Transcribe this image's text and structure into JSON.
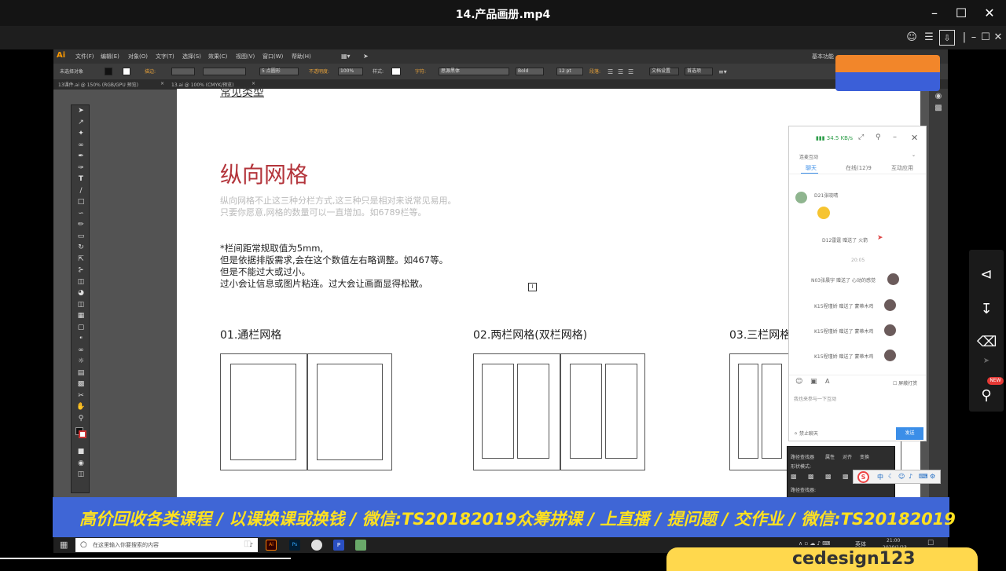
{
  "window": {
    "title": "14.产品画册.mp4"
  },
  "illustrator": {
    "logo": "Ai",
    "menu": [
      "文件(F)",
      "编辑(E)",
      "对象(O)",
      "文字(T)",
      "选择(S)",
      "效果(C)",
      "视图(V)",
      "窗口(W)",
      "帮助(H)"
    ],
    "workspace": "基本功能",
    "control": {
      "no_selection": "未选择对象",
      "stroke_label": "描边:",
      "stroke_type": "5 点圆形",
      "opacity_label": "不透明度:",
      "opacity": "100%",
      "style_label": "样式:",
      "char_label": "字符:",
      "font": "思源黑体",
      "weight": "Bold",
      "size": "12 pt",
      "para_label": "段落:",
      "doc_setup": "文档设置",
      "prefs": "首选项"
    },
    "tabs": [
      "13课件.ai @ 150% (RGB/GPU 预览)",
      "13.ai @ 100% (CMYK/预览)"
    ]
  },
  "artboard": {
    "cut_title": "常见类型",
    "title": "纵向网格",
    "sub": [
      "纵向网格不止这三种分栏方式,这三种只是相对来说常见易用。",
      "只要你愿意,网格的数量可以一直增加。如6789栏等。"
    ],
    "notes": [
      "*栏间距常规取值为5mm,",
      "但是依据排版需求,会在这个数值左右略调整。如467等。",
      "但是不能过大或过小。",
      "过小会让信息或图片粘连。过大会让画面显得松散。"
    ],
    "grids": [
      "01.通栏网格",
      "02.两栏网格(双栏网格)",
      "03.三栏网格"
    ]
  },
  "chat": {
    "speed": "34.5 KB/s",
    "section": "连麦互动",
    "tabs": [
      "聊天",
      "在线(12)9",
      "互动应用"
    ],
    "messages": [
      {
        "user": "D21张晓晴",
        "text": ""
      },
      {
        "user": "",
        "text": "D12雷霆 赠送了 火箭"
      },
      {
        "user": "",
        "text": "20:05"
      },
      {
        "user": "",
        "text": "N03张晨宇 赠送了 心动的感觉"
      },
      {
        "user": "",
        "text": "K15程瑾娇 赠送了 蒙蒂木鸡"
      },
      {
        "user": "",
        "text": "K15程瑾娇 赠送了 蒙蒂木鸡"
      },
      {
        "user": "",
        "text": "K15程瑾娇 赠送了 蒙蒂木鸡"
      }
    ],
    "input_placeholder": "我也来参与一下互动",
    "screen_lock": "屏蔽打赏",
    "mute": "禁止聊天",
    "send": "发送"
  },
  "layers_panel": {
    "tabs": [
      "路径查找器",
      "属性",
      "对齐",
      "变换"
    ],
    "shape_modes": "形状模式:",
    "pathfinder": "路径查找器:"
  },
  "ime": {
    "text": "中"
  },
  "banner": {
    "left": "高价回收各类课程 / 以课换课或换钱 / 微信:TS20182019",
    "right": "众筹拼课 / 上直播 / 提问题 / 交作业 / 微信:TS20182019"
  },
  "taskbar": {
    "search_placeholder": "在这里输入你要搜索的内容",
    "time": "21:00",
    "date": "2020/1/23",
    "lang": "英体"
  },
  "side": {
    "new_badge": "NEW"
  },
  "watermark": {
    "text": "cedesign123"
  },
  "colors": {
    "accent_red": "#b3343b",
    "banner_blue": "#3f66d6",
    "banner_text": "#ffe11f",
    "chat_send": "#3b8ee8"
  }
}
